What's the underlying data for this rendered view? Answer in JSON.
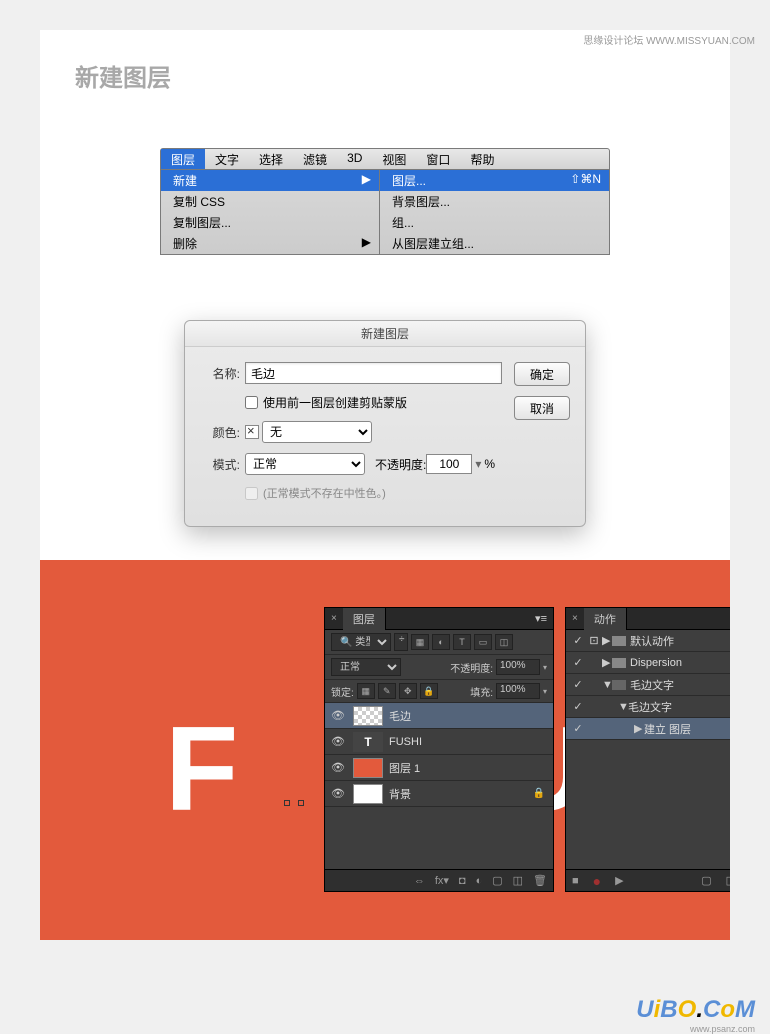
{
  "watermark": "思缘设计论坛  WWW.MISSYUAN.COM",
  "logo": {
    "text": "UiBO.CoM",
    "sub": "www.psanz.com"
  },
  "section_title": "新建图层",
  "menubar": [
    "图层",
    "文字",
    "选择",
    "滤镜",
    "3D",
    "视图",
    "窗口",
    "帮助"
  ],
  "submenu_left": [
    {
      "label": "新建",
      "active": true,
      "arrow": true
    },
    {
      "label": "复制 CSS"
    },
    {
      "label": "复制图层..."
    },
    {
      "label": "删除",
      "arrow": true
    }
  ],
  "submenu_right": [
    {
      "label": "图层...",
      "shortcut": "⇧⌘N",
      "active": true
    },
    {
      "label": "背景图层..."
    },
    {
      "label": "组..."
    },
    {
      "label": "从图层建立组..."
    }
  ],
  "dialog": {
    "title": "新建图层",
    "name_label": "名称:",
    "name_value": "毛边",
    "clip_label": "使用前一图层创建剪贴蒙版",
    "clip_checked": false,
    "color_label": "颜色:",
    "color_value": "无",
    "mode_label": "模式:",
    "mode_value": "正常",
    "opacity_label": "不透明度:",
    "opacity_value": "100",
    "opacity_unit": "%",
    "neutral_label": "(正常模式不存在中性色。)",
    "ok": "确定",
    "cancel": "取消"
  },
  "bg_text": "FU",
  "layers_panel": {
    "tab": "图层",
    "kind_label": "类型",
    "blend_mode": "正常",
    "opacity_label": "不透明度:",
    "opacity_value": "100%",
    "lock_label": "锁定:",
    "fill_label": "填充:",
    "fill_value": "100%",
    "layers": [
      {
        "name": "毛边",
        "thumb": "checker",
        "selected": true
      },
      {
        "name": "FUSHI",
        "thumb": "T"
      },
      {
        "name": "图层 1",
        "thumb": "orange"
      },
      {
        "name": "背景",
        "thumb": "white",
        "locked": true
      }
    ]
  },
  "actions_panel": {
    "tab": "动作",
    "items": [
      {
        "label": "默认动作",
        "indent": 0,
        "arrow": "▶",
        "folder": true,
        "check": true,
        "dot": true
      },
      {
        "label": "Dispersion",
        "indent": 0,
        "arrow": "▶",
        "folder": true,
        "check": true
      },
      {
        "label": "毛边文字",
        "indent": 0,
        "arrow": "▼",
        "folder": true,
        "open": true,
        "check": true
      },
      {
        "label": "毛边文字",
        "indent": 1,
        "arrow": "▼",
        "check": true
      },
      {
        "label": "建立 图层",
        "indent": 2,
        "arrow": "▶",
        "selected": true,
        "check": true
      }
    ]
  }
}
